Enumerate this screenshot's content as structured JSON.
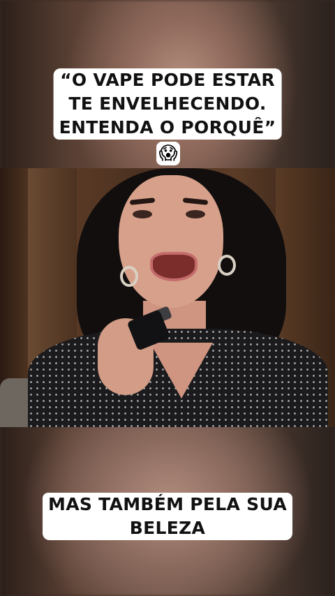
{
  "caption_top": {
    "lines": [
      "“O VAPE PODE ESTAR",
      "TE ENVELHECENDO.",
      "ENTENDA O PORQUÊ”"
    ],
    "emoji": "😱"
  },
  "caption_bottom": {
    "lines": [
      "MAS TAMBÉM PELA SUA",
      "BELEZA"
    ]
  },
  "colors": {
    "caption_bg": "#ffffff",
    "caption_text": "#111111"
  }
}
